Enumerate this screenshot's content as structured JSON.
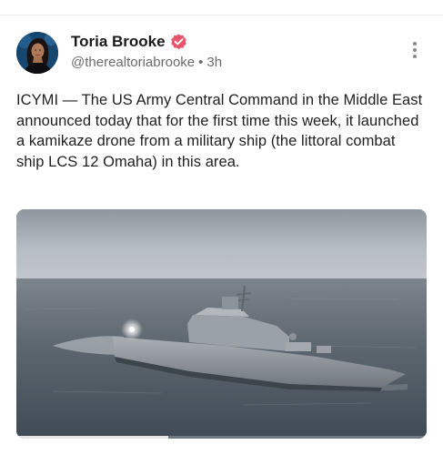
{
  "post": {
    "author": {
      "display_name": "Toria Brooke",
      "handle": "@therealtoriabrooke",
      "separator": "•",
      "time_ago": "3h",
      "verified_badge_color": "#e8556c"
    },
    "more_icon": "more-vertical-icon",
    "text": "ICYMI — The US Army Central Command in the Middle East announced today that for the first time this week, it launched a kamikaze drone from a military ship (the littoral combat ship LCS 12 Omaha) in this area.",
    "media": {
      "type": "video",
      "progress_fraction": 0.37
    }
  },
  "theme": {
    "text_primary": "#1f1f1f",
    "text_secondary": "#6b6b6b",
    "sea_color": "#5f6a74",
    "sky_color": "#b7bec5"
  }
}
